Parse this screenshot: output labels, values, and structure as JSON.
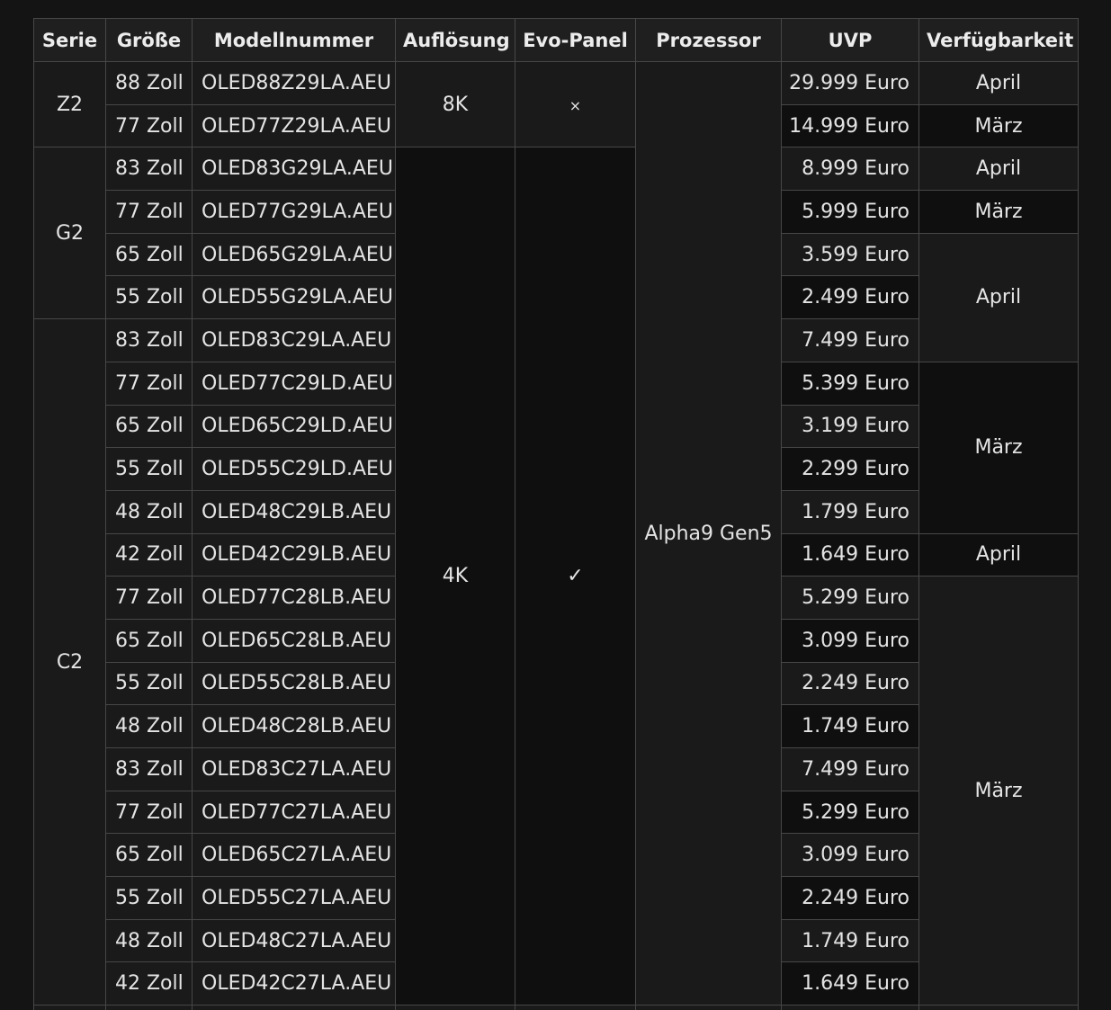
{
  "headers": [
    "Serie",
    "Größe",
    "Modellnummer",
    "Auflösung",
    "Evo-Panel",
    "Prozessor",
    "UVP",
    "Verfügbarkeit"
  ],
  "series": {
    "z2": "Z2",
    "g2": "G2",
    "c2": "C2"
  },
  "resolution": {
    "r8k": "8K",
    "r4k": "4K"
  },
  "evo": {
    "no": "×",
    "yes": "✓"
  },
  "processor": "Alpha9 Gen5",
  "availability": {
    "a1": "April",
    "a2": "März",
    "a3": "April",
    "a4": "März",
    "a5": "April",
    "a6": "März",
    "a7": "April",
    "a8": "März"
  },
  "rows": [
    {
      "size": "88 Zoll",
      "model": "OLED88Z29LA.AEU",
      "price": "29.999 Euro"
    },
    {
      "size": "77 Zoll",
      "model": "OLED77Z29LA.AEU",
      "price": "14.999 Euro"
    },
    {
      "size": "83 Zoll",
      "model": "OLED83G29LA.AEU",
      "price": "8.999 Euro"
    },
    {
      "size": "77 Zoll",
      "model": "OLED77G29LA.AEU",
      "price": "5.999 Euro"
    },
    {
      "size": "65 Zoll",
      "model": "OLED65G29LA.AEU",
      "price": "3.599 Euro"
    },
    {
      "size": "55 Zoll",
      "model": "OLED55G29LA.AEU",
      "price": "2.499 Euro"
    },
    {
      "size": "83 Zoll",
      "model": "OLED83C29LA.AEU",
      "price": "7.499 Euro"
    },
    {
      "size": "77 Zoll",
      "model": "OLED77C29LD.AEU",
      "price": "5.399 Euro"
    },
    {
      "size": "65 Zoll",
      "model": "OLED65C29LD.AEU",
      "price": "3.199 Euro"
    },
    {
      "size": "55 Zoll",
      "model": "OLED55C29LD.AEU",
      "price": "2.299 Euro"
    },
    {
      "size": "48 Zoll",
      "model": "OLED48C29LB.AEU",
      "price": "1.799 Euro"
    },
    {
      "size": "42 Zoll",
      "model": "OLED42C29LB.AEU",
      "price": "1.649 Euro"
    },
    {
      "size": "77 Zoll",
      "model": "OLED77C28LB.AEU",
      "price": "5.299 Euro"
    },
    {
      "size": "65 Zoll",
      "model": "OLED65C28LB.AEU",
      "price": "3.099 Euro"
    },
    {
      "size": "55 Zoll",
      "model": "OLED55C28LB.AEU",
      "price": "2.249 Euro"
    },
    {
      "size": "48 Zoll",
      "model": "OLED48C28LB.AEU",
      "price": "1.749 Euro"
    },
    {
      "size": "83 Zoll",
      "model": "OLED83C27LA.AEU",
      "price": "7.499 Euro"
    },
    {
      "size": "77 Zoll",
      "model": "OLED77C27LA.AEU",
      "price": "5.299 Euro"
    },
    {
      "size": "65 Zoll",
      "model": "OLED65C27LA.AEU",
      "price": "3.099 Euro"
    },
    {
      "size": "55 Zoll",
      "model": "OLED55C27LA.AEU",
      "price": "2.249 Euro"
    },
    {
      "size": "48 Zoll",
      "model": "OLED48C27LA.AEU",
      "price": "1.749 Euro"
    },
    {
      "size": "42 Zoll",
      "model": "OLED42C27LA.AEU",
      "price": "1.649 Euro"
    }
  ]
}
